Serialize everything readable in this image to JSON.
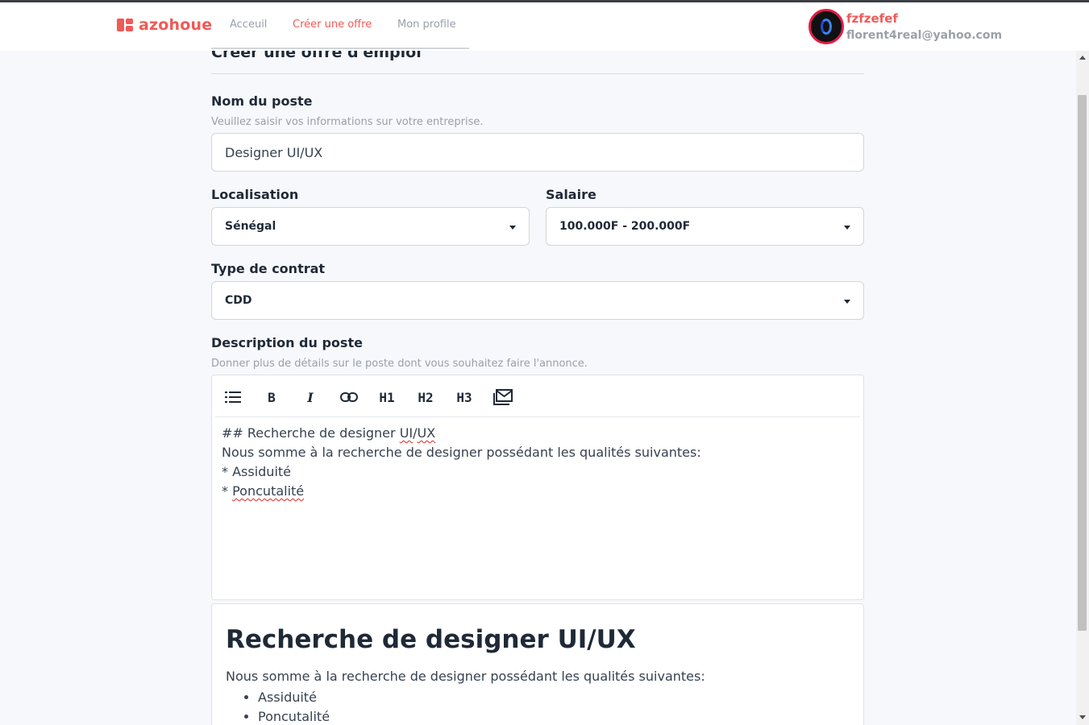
{
  "brand": {
    "name": "azohoue",
    "color": "#f05a57"
  },
  "nav": {
    "links": [
      {
        "label": "Acceuil"
      },
      {
        "label": "Créer une offre"
      },
      {
        "label": "Mon profile"
      }
    ],
    "active_index": 1
  },
  "user": {
    "name": "fzfzefef",
    "email": "florent4real@yahoo.com"
  },
  "form": {
    "heading": "Créer une offre d'emploi",
    "job_title": {
      "label": "Nom du poste",
      "hint": "Veuillez saisir vos informations sur votre entreprise.",
      "value": "Designer UI/UX"
    },
    "location": {
      "label": "Localisation",
      "value": "Sénégal"
    },
    "salary": {
      "label": "Salaire",
      "value": "100.000F - 200.000F"
    },
    "contract": {
      "label": "Type de contrat",
      "value": "CDD"
    },
    "description": {
      "label": "Description du poste",
      "hint": "Donner plus de détails sur le poste dont vous souhaitez faire l'annonce.",
      "toolbar": [
        {
          "icon": "list-icon",
          "text": ""
        },
        {
          "icon": "bold-icon",
          "text": "B"
        },
        {
          "icon": "italic-icon",
          "text": "I"
        },
        {
          "icon": "link-icon",
          "text": ""
        },
        {
          "icon": "heading1-icon",
          "text": "H1"
        },
        {
          "icon": "heading2-icon",
          "text": "H2"
        },
        {
          "icon": "heading3-icon",
          "text": "H3"
        },
        {
          "icon": "mail-icon",
          "text": ""
        }
      ],
      "editor_lines": {
        "line1_prefix": "## Recherche de designer ",
        "line1_ui": "UI",
        "line1_sep": "/",
        "line1_ux": "UX",
        "line2": "Nous somme à la recherche de designer possédant les qualités suivantes:",
        "line3": "* Assiduité",
        "line4_prefix": "* ",
        "line4_word": "Poncutalité"
      }
    },
    "preview": {
      "heading": "Recherche de designer UI/UX",
      "paragraph": "Nous somme à la recherche de designer possédant les qualités suivantes:",
      "items": [
        "Assiduité",
        "Poncutalité"
      ]
    }
  }
}
